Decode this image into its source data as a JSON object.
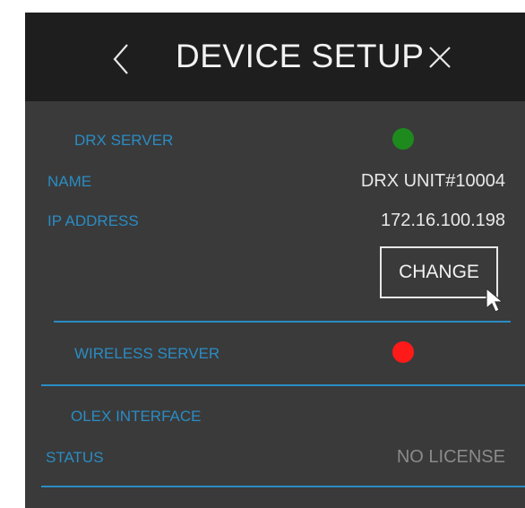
{
  "header": {
    "title": "DEVICE SETUP",
    "back_icon": "chevron-left-icon",
    "close_icon": "close-icon"
  },
  "drx_server": {
    "section_label": "DRX SERVER",
    "status_color": "#1e8a1e",
    "name_label": "NAME",
    "name_value": "DRX UNIT#10004",
    "ip_label": "IP ADDRESS",
    "ip_value": "172.16.100.198",
    "change_label": "CHANGE"
  },
  "wireless_server": {
    "section_label": "WIRELESS SERVER",
    "status_color": "#ff1a1a"
  },
  "olex_interface": {
    "section_label": "OLEX INTERFACE",
    "status_label": "STATUS",
    "status_value": "NO LICENSE"
  },
  "colors": {
    "accent": "#2a8cc4",
    "header_bg": "#1e1e1e",
    "panel_bg": "#3a3a3a"
  }
}
